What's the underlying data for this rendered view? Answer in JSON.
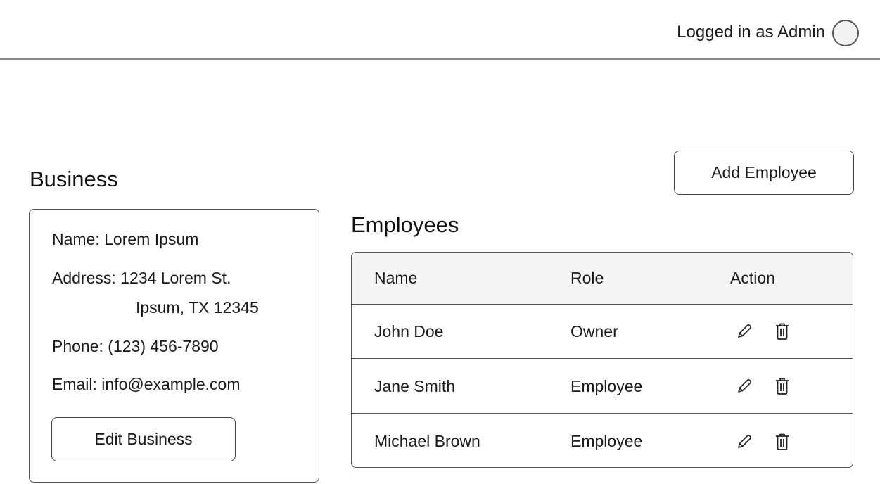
{
  "header": {
    "user_status": "Logged in as Admin"
  },
  "business": {
    "section_title": "Business",
    "name_line": "Name: Lorem Ipsum",
    "address_line1": "Address: 1234 Lorem St.",
    "address_line2": "Ipsum, TX 12345",
    "phone_line": "Phone: (123) 456-7890",
    "email_line": "Email: info@example.com",
    "edit_button": "Edit Business"
  },
  "employees": {
    "add_button": "Add Employee",
    "section_title": "Employees",
    "columns": [
      "Name",
      "Role",
      "Action"
    ],
    "rows": [
      {
        "name": "John Doe",
        "role": "Owner",
        "actions": [
          "pencil-icon",
          "trash-icon"
        ]
      },
      {
        "name": "Jane Smith",
        "role": "Employee",
        "actions": [
          "pencil-icon",
          "trash-icon"
        ]
      },
      {
        "name": "Michael Brown",
        "role": "Employee",
        "actions": [
          "pencil-icon",
          "trash-icon"
        ]
      }
    ]
  }
}
